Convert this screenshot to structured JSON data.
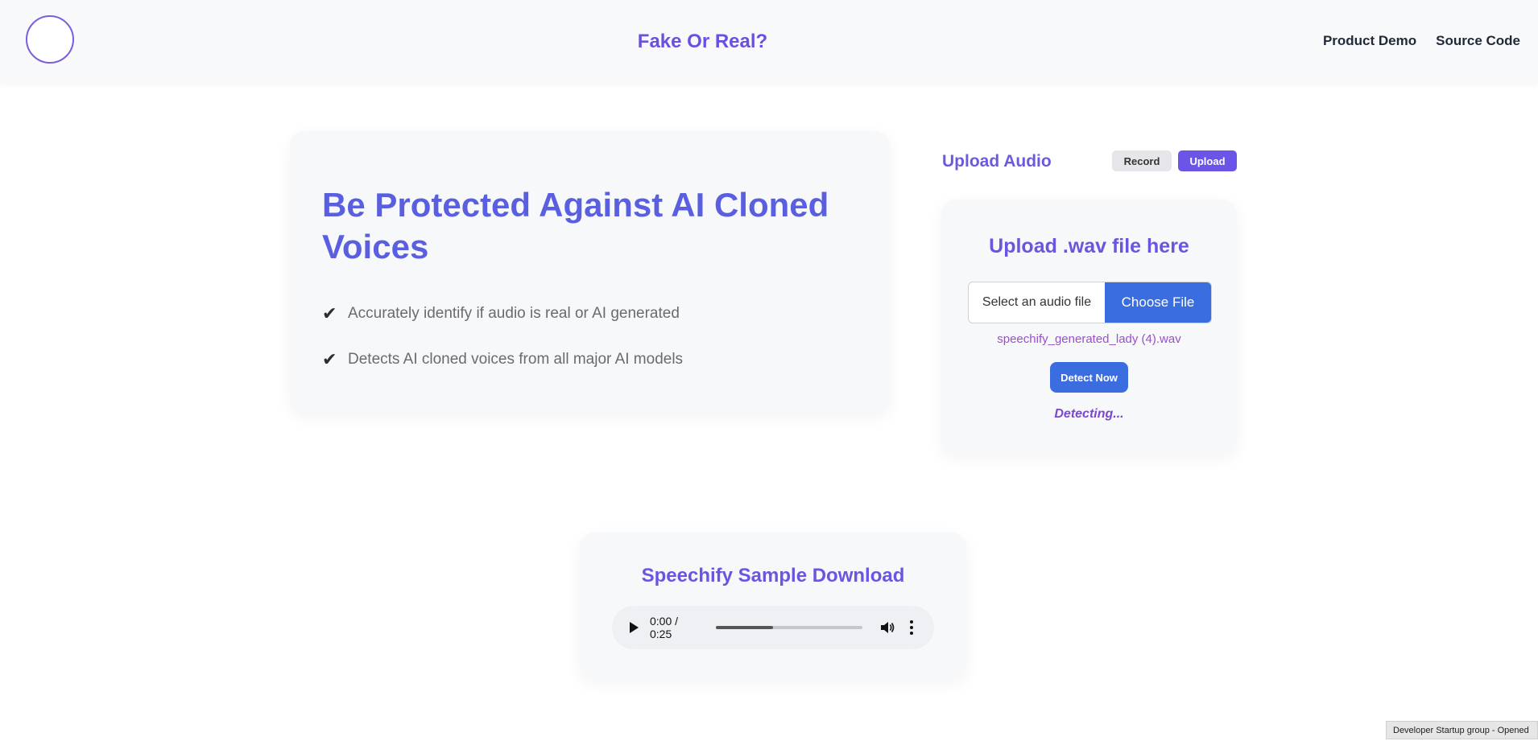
{
  "header": {
    "logo_icon": "sound-wave-icon",
    "title": "Fake Or Real?",
    "nav": [
      {
        "label": "Product Demo"
      },
      {
        "label": "Source Code"
      }
    ]
  },
  "hero": {
    "title": "Be Protected Against AI Cloned Voices",
    "features": [
      {
        "icon": "check-icon",
        "text": "Accurately identify if audio is real or AI generated"
      },
      {
        "icon": "check-icon",
        "text": "Detects AI cloned voices from all major AI models"
      }
    ]
  },
  "upload_panel": {
    "heading": "Upload Audio",
    "mode_buttons": {
      "record": "Record",
      "upload": "Upload",
      "active": "upload"
    },
    "card_title": "Upload .wav file here",
    "file_placeholder": "Select an audio file",
    "choose_label": "Choose File",
    "selected_file": "speechify_generated_lady (4).wav",
    "detect_label": "Detect Now",
    "status": "Detecting..."
  },
  "sample": {
    "title": "Speechify Sample Download",
    "player": {
      "time": "0:00 / 0:25",
      "progress": 0.39,
      "icons": [
        "play-icon",
        "volume-icon",
        "more-options-icon"
      ]
    }
  },
  "footer": {
    "tag": "Developer Startup group - Opened"
  },
  "colors": {
    "brand_purple": "#6a55e0",
    "hero_blue": "#5a5fe0",
    "action_blue": "#3a6ee0",
    "filename_purple": "#9a4fc7"
  }
}
